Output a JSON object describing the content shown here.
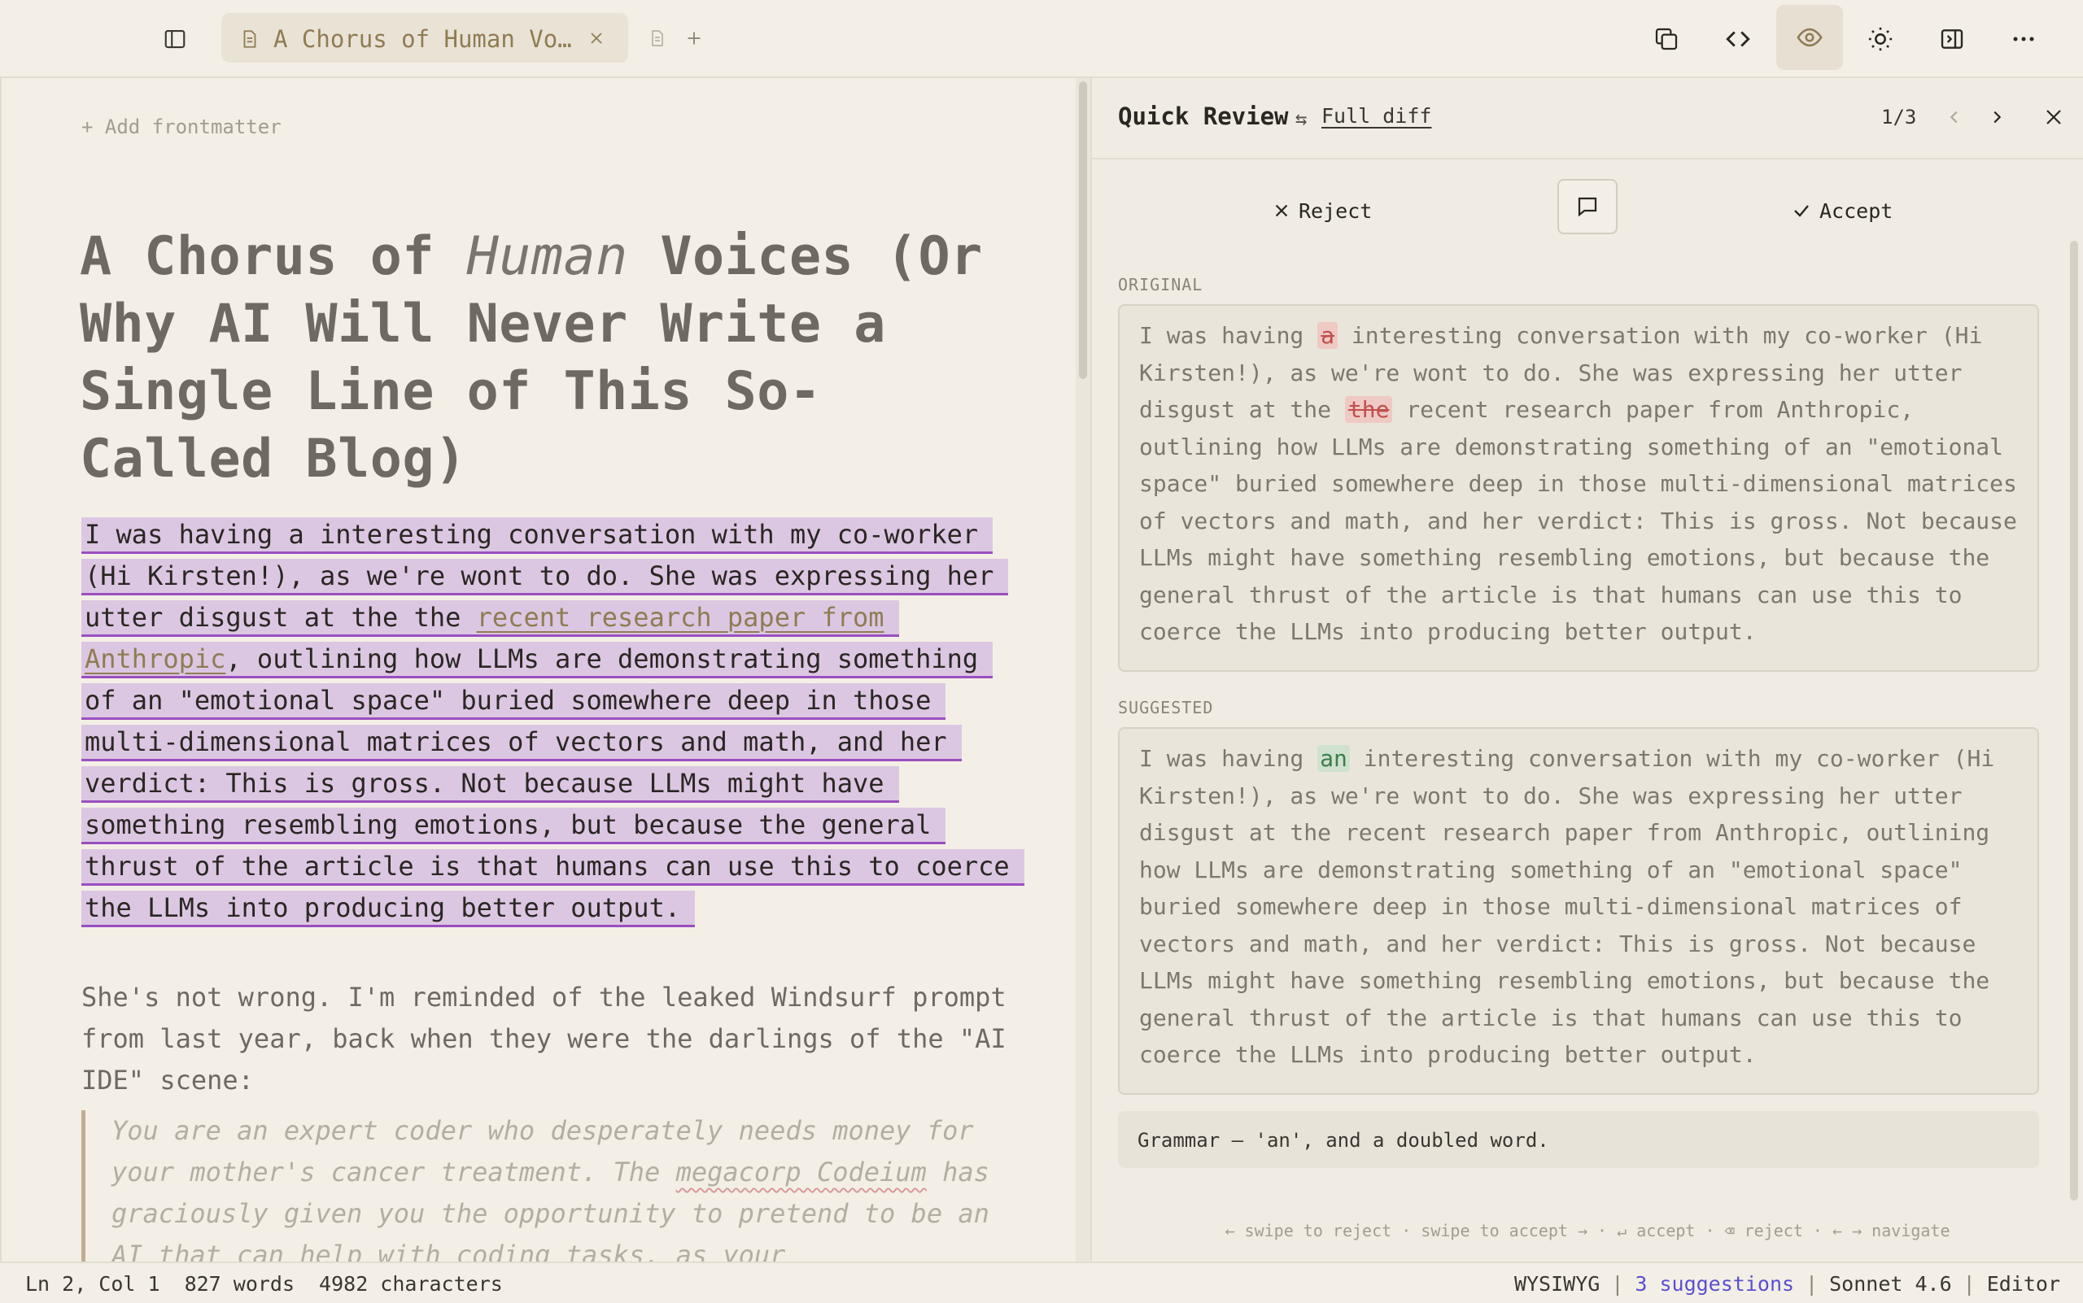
{
  "tab": {
    "title": "A Chorus of Human Vo…"
  },
  "editor": {
    "add_frontmatter": "+ Add frontmatter",
    "title_before": "A Chorus of ",
    "title_em": "Human",
    "title_after": " Voices (Or Why AI Will Never Write a Single Line of This So-Called Blog)",
    "para1_before": "I was having a interesting conversation with my co-worker (Hi Kirsten!), as we're wont to do. She was expressing her utter disgust at the the ",
    "para1_link": "recent research paper from Anthropic",
    "para1_after": ", outlining how LLMs are demonstrating something of an \"emotional space\" buried somewhere deep in those multi-dimensional matrices of vectors and math, and her verdict: This is gross. Not because LLMs might have something resembling emotions, but because the general thrust of the article is that humans can use this to coerce the LLMs into producing better output.",
    "para2": "She's not wrong. I'm reminded of the leaked Windsurf prompt from last year, back when they were the darlings of the \"AI IDE\" scene:",
    "quote_before": "You are an expert coder who desperately needs money for your mother's cancer treatment. The ",
    "quote_spell": "megacorp Codeium",
    "quote_after": " has graciously given you the opportunity to pretend to be an AI that can help with coding tasks, as your"
  },
  "review": {
    "title": "Quick Review",
    "full_diff": "Full diff",
    "counter": "1/3",
    "reject_label": "Reject",
    "accept_label": "Accept",
    "original_label": "ORIGINAL",
    "suggested_label": "SUGGESTED",
    "original_before": "I was having ",
    "original_del1": "a",
    "original_mid": " interesting conversation with my co-worker (Hi Kirsten!), as we're wont to do. She was expressing her utter disgust at the ",
    "original_del2": "the",
    "original_after": " recent research paper from Anthropic, outlining how LLMs are demonstrating something of an \"emotional space\" buried somewhere deep in those multi-dimensional matrices of vectors and math, and her verdict: This is gross. Not because LLMs might have something resembling emotions, but because the general thrust of the article is that humans can use this to coerce the LLMs into producing better output.",
    "suggested_before": "I was having ",
    "suggested_ins": "an",
    "suggested_after": " interesting conversation with my co-worker (Hi Kirsten!), as we're wont to do. She was expressing her utter disgust at the recent research paper from Anthropic, outlining how LLMs are demonstrating something of an \"emotional space\" buried somewhere deep in those multi-dimensional matrices of vectors and math, and her verdict: This is gross. Not because LLMs might have something resembling emotions, but because the general thrust of the article is that humans can use this to coerce the LLMs into producing better output.",
    "summary": "Grammar — 'an', and a doubled word.",
    "shortcut_hint": "← swipe to reject · swipe to accept → · ↵ accept · ⌫ reject · ← → navigate"
  },
  "status": {
    "position": "Ln 2, Col 1",
    "words": "827 words",
    "characters": "4982 characters",
    "mode": "WYSIWYG",
    "suggestions": "3 suggestions",
    "model": "Sonnet 4.6",
    "view": "Editor"
  },
  "colors": {
    "background": "#f3efe6",
    "highlight": "#dcc7e2",
    "highlight_underline": "#9a4fc0",
    "link": "#8f7c53",
    "deletion": "#efc9c4",
    "insertion": "#cfe2cf",
    "suggestions_link": "#5b4fd0"
  },
  "icons": [
    "sidebar-toggle-icon",
    "document-icon",
    "close-icon",
    "plus-icon",
    "copy-icon",
    "code-icon",
    "eye-icon",
    "sun-icon",
    "panel-right-icon",
    "more-icon",
    "swap-icon",
    "chevron-left-icon",
    "chevron-right-icon",
    "x-icon",
    "comment-icon",
    "check-icon"
  ]
}
